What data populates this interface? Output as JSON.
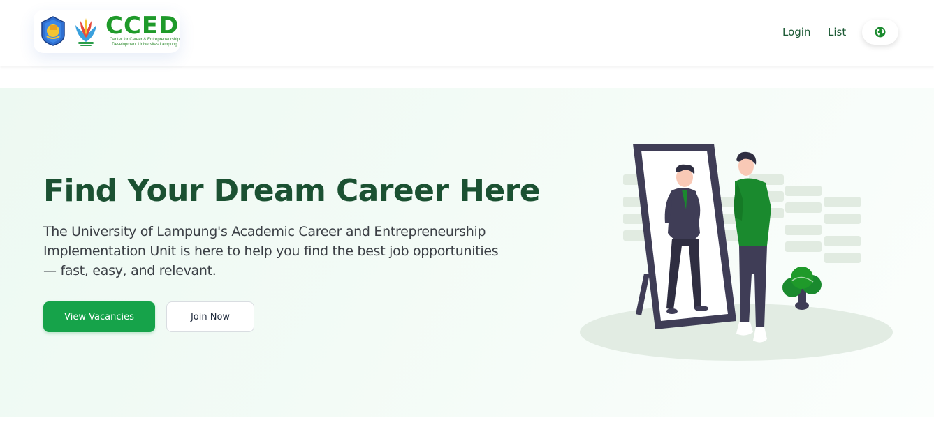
{
  "header": {
    "brand": {
      "name": "CCED",
      "subtitle_line1": "Center for Career & Entrepreneurship",
      "subtitle_line2": "Development Universitas Lampung"
    },
    "nav": {
      "login_label": "Login",
      "list_label": "List"
    },
    "language_icon": "globe-icon"
  },
  "hero": {
    "title": "Find Your Dream Career Here",
    "description": "The University of Lampung's Academic Career and Entrepreneurship Implementation Unit is here to help you find the best job opportunities — fast, easy, and relevant.",
    "primary_button_label": "View Vacancies",
    "secondary_button_label": "Join Now"
  },
  "colors": {
    "brand_green": "#1f9a2a",
    "title_green": "#1b5132",
    "button_green": "#16a34a",
    "hero_background": "#edf9f2"
  }
}
